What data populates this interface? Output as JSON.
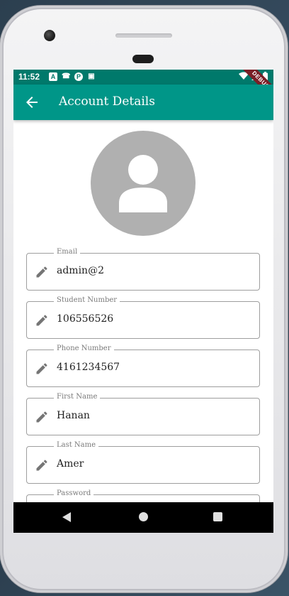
{
  "status_bar": {
    "time": "11:52",
    "notification_icons": [
      "A",
      "☎",
      "P",
      "▣"
    ],
    "debug_banner": "DEBUG"
  },
  "app_bar": {
    "title": "Account Details"
  },
  "fields": [
    {
      "label": "Email",
      "value": "admin@2"
    },
    {
      "label": "Student Number",
      "value": "106556526"
    },
    {
      "label": "Phone Number",
      "value": "4161234567"
    },
    {
      "label": "First Name",
      "value": "Hanan"
    },
    {
      "label": "Last Name",
      "value": "Amer"
    },
    {
      "label": "Password",
      "value": ""
    }
  ],
  "colors": {
    "status_bar": "#00796b",
    "app_bar": "#009688",
    "avatar_bg": "#b0b0b0",
    "icon_gray": "#757575"
  }
}
